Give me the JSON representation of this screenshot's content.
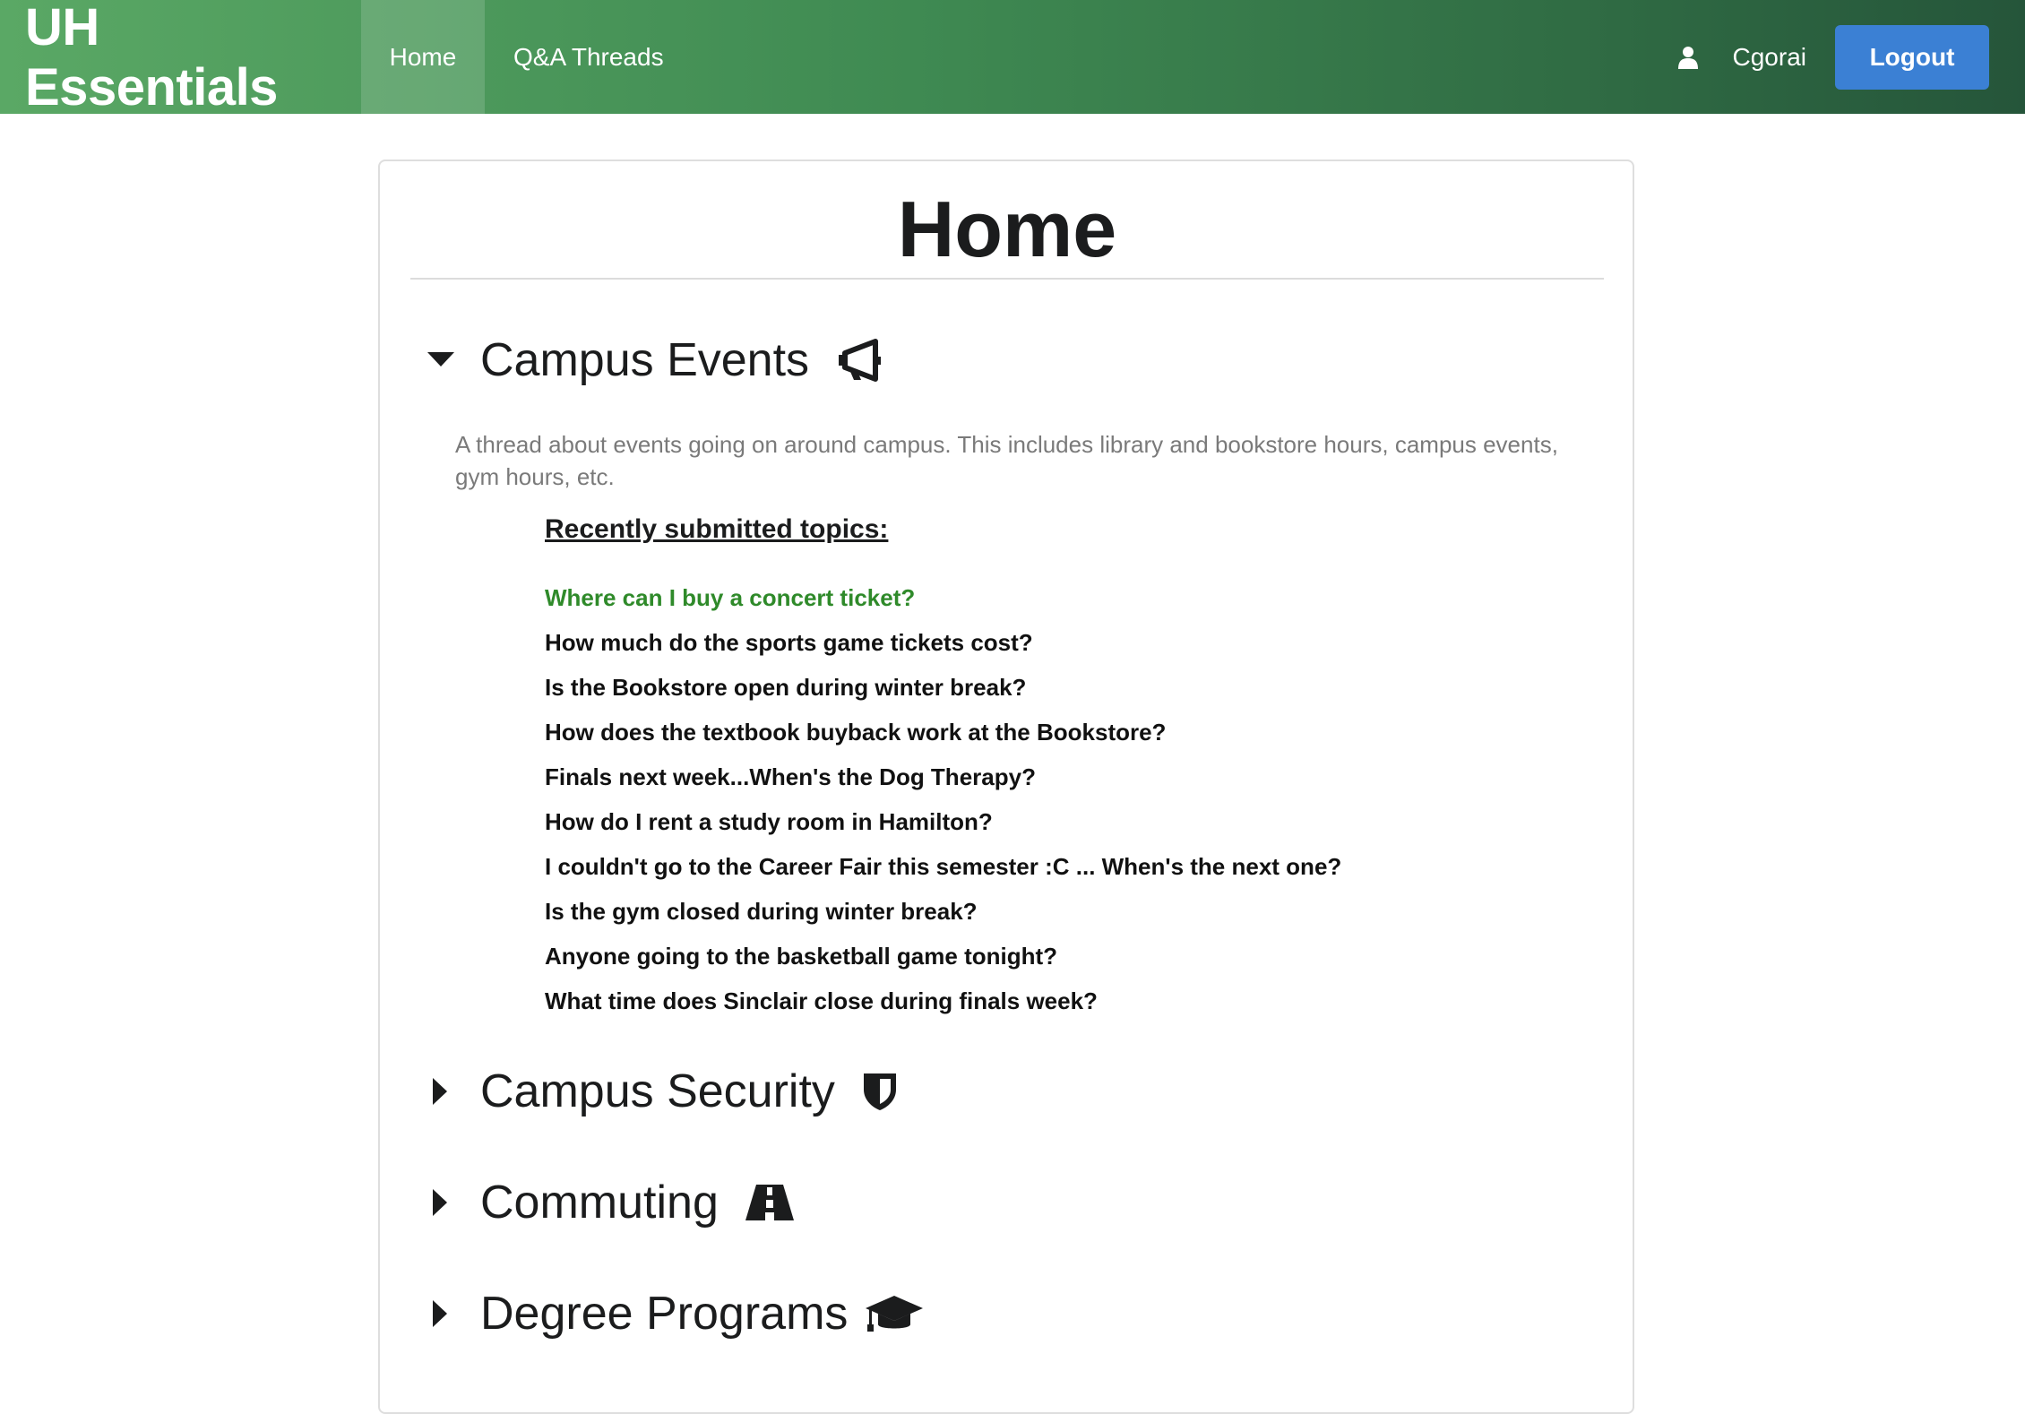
{
  "navbar": {
    "brand": "UH Essentials",
    "links": [
      {
        "label": "Home",
        "active": true
      },
      {
        "label": "Q&A Threads",
        "active": false
      }
    ],
    "user_icon": "user-icon",
    "username": "Cgorai",
    "logout_label": "Logout"
  },
  "main": {
    "title": "Home",
    "sections": [
      {
        "label": "Campus Events",
        "icon": "bullhorn-icon",
        "expanded": true,
        "description": "A thread about events going on around campus. This includes library and bookstore hours, campus events, gym hours, etc.",
        "recent_heading": "Recently submitted topics:",
        "topics": [
          "Where can I buy a concert ticket?",
          "How much do the sports game tickets cost?",
          "Is the Bookstore open during winter break?",
          "How does the textbook buyback work at the Bookstore?",
          "Finals next week...When's the Dog Therapy?",
          "How do I rent a study room in Hamilton?",
          "I couldn't go to the Career Fair this semester :C ... When's the next one?",
          "Is the gym closed during winter break?",
          "Anyone going to the basketball game tonight?",
          "What time does Sinclair close during finals week?"
        ]
      },
      {
        "label": "Campus Security",
        "icon": "shield-icon",
        "expanded": false
      },
      {
        "label": "Commuting",
        "icon": "road-icon",
        "expanded": false
      },
      {
        "label": "Degree Programs",
        "icon": "graduation-cap-icon",
        "expanded": false
      }
    ]
  },
  "colors": {
    "nav_gradient_start": "#5aa865",
    "nav_gradient_end": "#25553a",
    "logout_button": "#3b80d4",
    "highlighted_topic": "#2f8a2a",
    "description_text": "#7a7a7a"
  }
}
